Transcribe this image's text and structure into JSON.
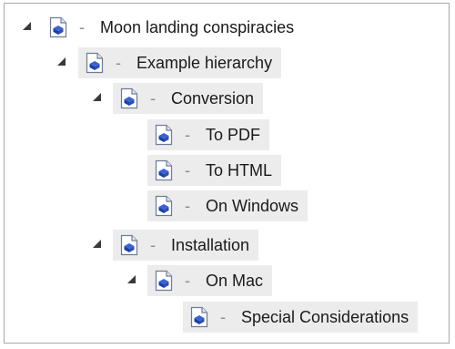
{
  "tree": {
    "nodes": [
      {
        "id": "moon-landing",
        "label": "Moon landing conspiracies",
        "separator": "-",
        "icon": "document-icon",
        "expanded": true,
        "level": 0
      },
      {
        "id": "example-hierarchy",
        "label": "Example hierarchy",
        "separator": "-",
        "icon": "document-icon",
        "expanded": true,
        "level": 1
      },
      {
        "id": "conversion",
        "label": "Conversion",
        "separator": "-",
        "icon": "document-icon",
        "expanded": true,
        "level": 2
      },
      {
        "id": "to-pdf",
        "label": "To PDF",
        "separator": "-",
        "icon": "document-icon",
        "level": 3
      },
      {
        "id": "to-html",
        "label": "To HTML",
        "separator": "-",
        "icon": "document-icon",
        "level": 3
      },
      {
        "id": "on-windows",
        "label": "On Windows",
        "separator": "-",
        "icon": "document-icon",
        "level": 3
      },
      {
        "id": "installation",
        "label": "Installation",
        "separator": "-",
        "icon": "document-icon",
        "expanded": true,
        "level": 2
      },
      {
        "id": "on-mac",
        "label": "On Mac",
        "separator": "-",
        "icon": "document-icon",
        "expanded": true,
        "level": 3
      },
      {
        "id": "special-considerations",
        "label": "Special Considerations",
        "separator": "-",
        "icon": "document-icon",
        "level": 4
      }
    ]
  },
  "colors": {
    "node_background": "#ececec",
    "border": "#a8a8a8",
    "icon_blue": "#2a4fb8"
  }
}
